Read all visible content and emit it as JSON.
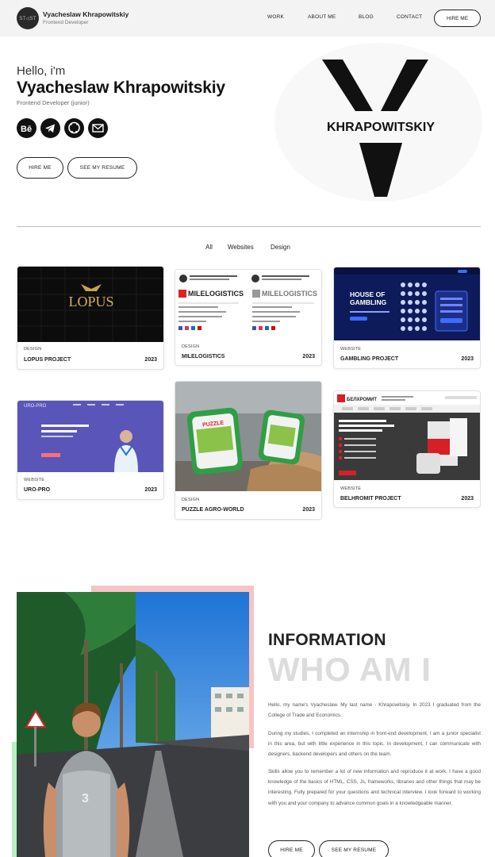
{
  "header": {
    "logo_text": "ST◁ST",
    "name": "Vyacheslaw Khrapowitskiy",
    "role": "Frontend Developer",
    "nav": [
      "WORK",
      "ABOUT ME",
      "BLOG",
      "CONTACT"
    ],
    "hire_label": "HIRE ME"
  },
  "hero": {
    "greeting": "Hello, i'm",
    "name": "Vyacheslaw Khrapowitskiy",
    "role": "Frontend Developer (junior)",
    "socials": [
      "behance-icon",
      "telegram-icon",
      "github-icon",
      "mail-icon"
    ],
    "hire_label": "HIRE ME",
    "resume_label": "SEE MY RESUME",
    "logo_text": "KHRAPOWITSKIY"
  },
  "filters": [
    "All",
    "Websites",
    "Design"
  ],
  "projects": [
    {
      "category": "DESIGN",
      "title": "LOPUS PROJECT",
      "year": "2023",
      "thumb_text": "LOPUS"
    },
    {
      "category": "DESIGN",
      "title": "MILELOGISTICS",
      "year": "2023",
      "thumb_text": "MILELOGISTICS"
    },
    {
      "category": "WEBSITE",
      "title": "GAMBLING PROJECT",
      "year": "2023",
      "thumb_text": "HOUSE OF GAMBLING"
    },
    {
      "category": "WEBSITE",
      "title": "URO-PRO",
      "year": "2023",
      "thumb_text": "URO-PRO"
    },
    {
      "category": "DESIGN",
      "title": "PUZZLE AGRO-WORLD",
      "year": "2023",
      "thumb_text": "PUZZLE AGRO-WORLD"
    },
    {
      "category": "WEBSITE",
      "title": "BELHROMIT PROJECT",
      "year": "2023",
      "thumb_text": "БЕЛХРОМИТ"
    }
  ],
  "about": {
    "heading": "INFORMATION",
    "subheading": "WHO AM I",
    "paragraphs": [
      "Hello, my name's Vyacheslaw. My last name - Khrapowitskiy. In 2023 I graduated from the College of Trade and Economics.",
      "During my studies, I completed an internship in front-end development, I am a junior specialist in this area, but with little experience in this topic. In development, I can communicate with designers, backend developers and others on the team.",
      "Skills allow you to remember a lot of new information and reproduce it at work. I have a good knowledge of the basics of HTML, CSS, Js, frameworks, libraries and other things that may be interesting. Fully prepared for your questions and technical interview. I look forward to working with you and your company to advance common goals in a knowledgeable manner."
    ],
    "hire_label": "HIRE ME",
    "resume_label": "SEE MY RESUME"
  }
}
